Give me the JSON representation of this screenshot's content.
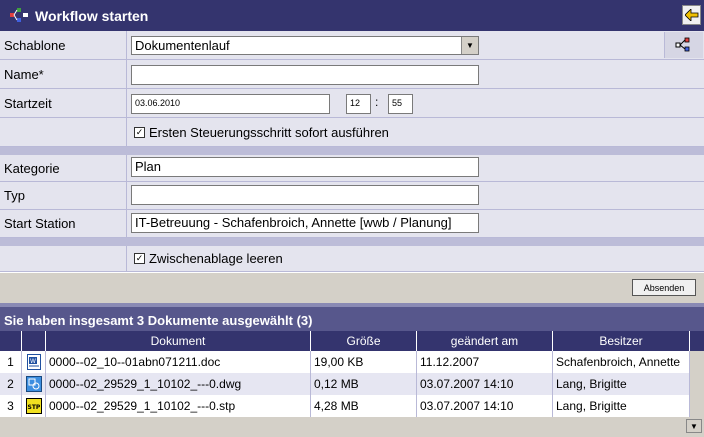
{
  "window": {
    "title": "Workflow starten"
  },
  "form": {
    "template": {
      "label": "Schablone",
      "value": "Dokumentenlauf"
    },
    "name": {
      "label": "Name*",
      "value": ""
    },
    "start_time": {
      "label": "Startzeit",
      "date": "03.06.2010",
      "hour": "12",
      "separator": ":",
      "minute": "55"
    },
    "first_step": {
      "label": "Ersten Steuerungsschritt sofort ausführen",
      "checked": true
    },
    "category": {
      "label": "Kategorie",
      "value": "Plan"
    },
    "type": {
      "label": "Typ",
      "value": ""
    },
    "start_station": {
      "label": "Start Station",
      "value": "IT-Betreuung - Schafenbroich, Annette [wwb / Planung]"
    },
    "clear_clipboard": {
      "label": "Zwischenablage leeren",
      "checked": true
    },
    "submit_label": "Absenden"
  },
  "selection": {
    "summary": "Sie haben insgesamt 3 Dokumente ausgewählt (3)",
    "columns": [
      "Dokument",
      "Größe",
      "geändert am",
      "Besitzer"
    ],
    "rows": [
      {
        "num": "1",
        "icon": "word-document-icon",
        "document": "0000--02_10--01abn071211.doc",
        "size": "19,00 KB",
        "modified": "11.12.2007",
        "owner": "Schafenbroich, Annette"
      },
      {
        "num": "2",
        "icon": "dwg-drawing-icon",
        "document": "0000--02_29529_1_10102_---0.dwg",
        "size": "0,12 MB",
        "modified": "03.07.2007 14:10",
        "owner": "Lang, Brigitte"
      },
      {
        "num": "3",
        "icon": "stp-file-icon",
        "document": "0000--02_29529_1_10102_---0.stp",
        "size": "4,28 MB",
        "modified": "03.07.2007 14:10",
        "owner": "Lang, Brigitte"
      }
    ]
  },
  "colors": {
    "title_bar": "#34346e",
    "form_bg": "#e4e4ee",
    "separator": "#bcbcd8",
    "header_bar": "#57578c"
  }
}
